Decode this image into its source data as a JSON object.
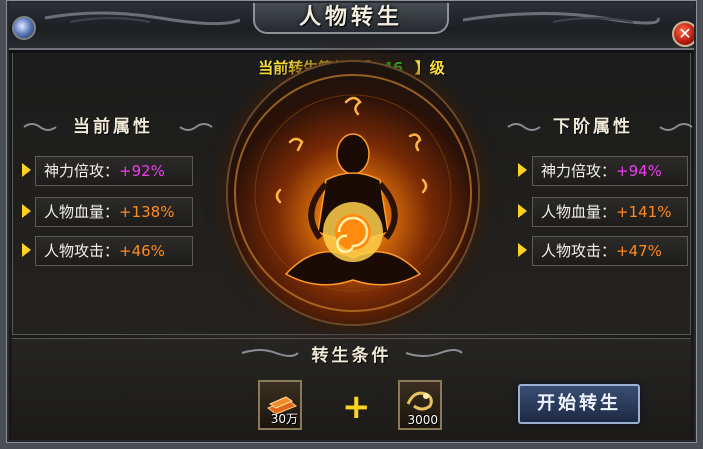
{
  "window": {
    "title": "人物转生",
    "close_label": "✕"
  },
  "level": {
    "label": "当前转生等级：",
    "bracket_open": "【",
    "value": "46",
    "bracket_close": "】级"
  },
  "current": {
    "heading": "当前属性",
    "rows": [
      {
        "name": "神力倍攻：",
        "value": "+92%",
        "color": "#f03cf0"
      },
      {
        "name": "人物血量：",
        "value": "+138%",
        "color": "#ff8a1e"
      },
      {
        "name": "人物攻击：",
        "value": "+46%",
        "color": "#ff8a1e"
      }
    ]
  },
  "next": {
    "heading": "下阶属性",
    "rows": [
      {
        "name": "神力倍攻：",
        "value": "+94%",
        "color": "#f03cf0"
      },
      {
        "name": "人物血量：",
        "value": "+141%",
        "color": "#ff8a1e"
      },
      {
        "name": "人物攻击：",
        "value": "+47%",
        "color": "#ff8a1e"
      }
    ]
  },
  "conditions": {
    "heading": "转生条件",
    "items": [
      {
        "icon": "gold-bars-icon",
        "qty": "30万"
      },
      {
        "icon": "dragon-token-icon",
        "qty": "3000"
      }
    ],
    "plus": "+"
  },
  "actions": {
    "start_label": "开始转生"
  },
  "colors": {
    "level_label": "#ffe43a",
    "level_value": "#35e835",
    "button_bg": "#2a3a5a"
  }
}
